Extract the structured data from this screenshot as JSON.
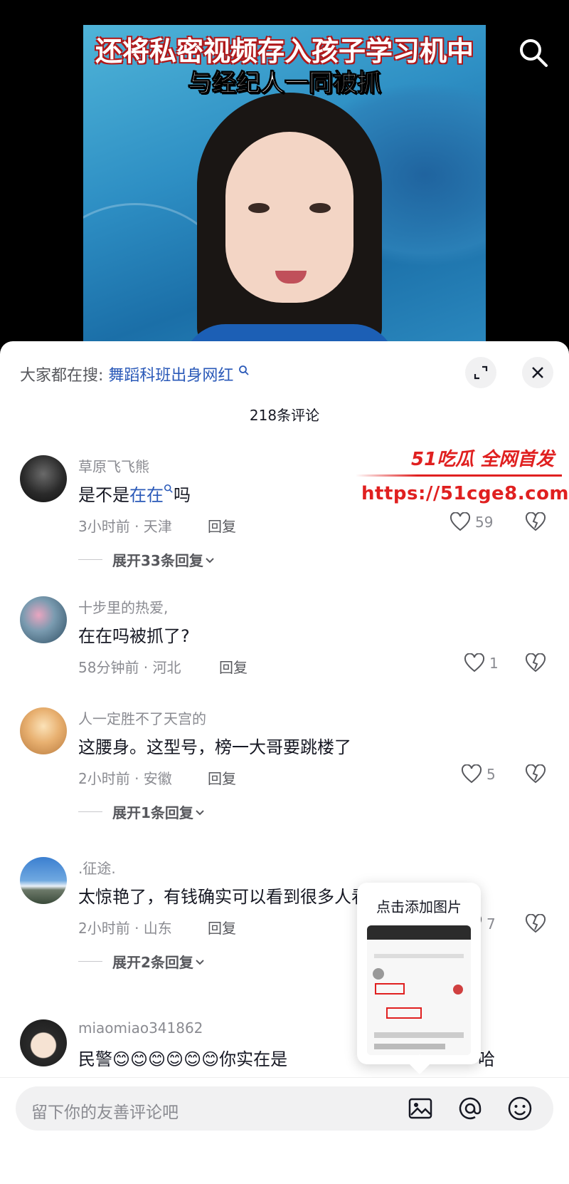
{
  "video": {
    "caption_line1": "还将私密视频存入孩子学习机中",
    "caption_line2": "与经纪人一同被抓"
  },
  "sheet": {
    "trending_prefix": "大家都在搜:",
    "trending_keyword": "舞蹈科班出身网红",
    "comment_count": "218条评论"
  },
  "watermark": {
    "title": "51吃瓜 全网首发",
    "url": "https://51cge8.com"
  },
  "comments": [
    {
      "user": "草原飞飞熊",
      "text_before": "是不是",
      "text_link": "在在",
      "text_after": "吗",
      "time_loc": "3小时前 · 天津",
      "reply": "回复",
      "likes": "59",
      "expand": "展开33条回复"
    },
    {
      "user": "十步里的热爱,",
      "text": "在在吗被抓了?",
      "time_loc": "58分钟前 · 河北",
      "reply": "回复",
      "likes": "1"
    },
    {
      "user": "人一定胜不了天宫的",
      "text": "这腰身。这型号，榜一大哥要跳楼了",
      "time_loc": "2小时前 · 安徽",
      "reply": "回复",
      "likes": "5",
      "expand": "展开1条回复"
    },
    {
      "user": ".征途.",
      "text": "太惊艳了，有钱确实可以看到很多人看不到的东西",
      "time_loc": "2小时前 · 山东",
      "reply": "回复",
      "likes": "7",
      "expand": "展开2条回复"
    },
    {
      "user": "miaomiao341862",
      "text_before": "民警",
      "emoji": "😊😊😊😊😊😊",
      "text_after": "你实在是",
      "text_end": "哈"
    }
  ],
  "popup": {
    "title": "点击添加图片"
  },
  "input": {
    "placeholder": "留下你的友善评论吧"
  },
  "icons": {
    "search": "search-icon",
    "expand": "expand-icon",
    "close": "close-icon",
    "heart": "heart-icon",
    "dislike": "broken-heart-icon",
    "image": "image-icon",
    "mention": "at-icon",
    "emoji": "emoji-icon"
  }
}
